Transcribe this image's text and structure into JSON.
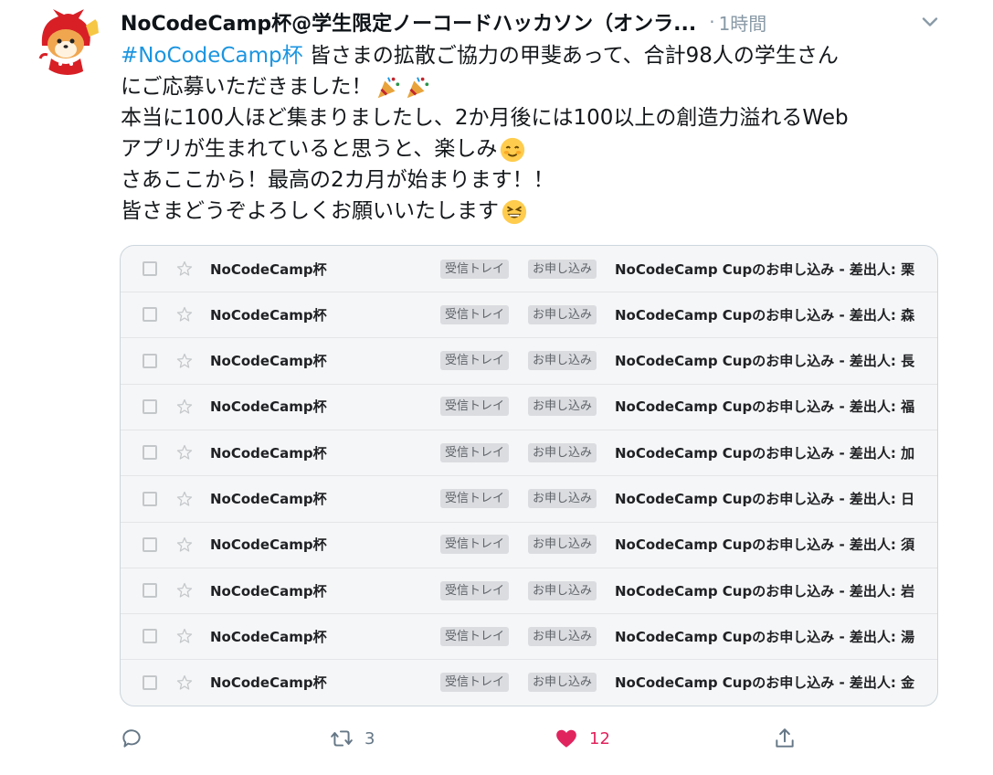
{
  "tweet": {
    "display_name": "NoCodeCamp杯@学生限定ノーコードハッカソン（オンラ...",
    "separator": "·",
    "time": "1時間",
    "hashtag": "#NoCodeCamp杯",
    "line1_rest": " 皆さまの拡散ご協力の甲斐あって、合計98人の学生さん",
    "line2": "にご応募いただきました！",
    "line3": "本当に100人ほど集まりましたし、2か月後には100以上の創造力溢れるWeb",
    "line4": "アプリが生まれていると思うと、楽しみ",
    "line5": "さあここから！最高の2カ月が始まります！！",
    "line6": "皆さまどうぞよろしくお願いいたします"
  },
  "icons": {
    "avatar": "mascot-avatar",
    "caret": "chevron-down-icon",
    "reply": "reply-icon",
    "retweet": "retweet-icon",
    "like": "heart-icon",
    "share": "share-icon",
    "emoji_party": "party-popper-icon",
    "emoji_smile": "smiling-face-icon",
    "emoji_grin": "grinning-squinting-face-icon"
  },
  "media": {
    "rows": [
      {
        "sender": "NoCodeCamp杯",
        "label1": "受信トレイ",
        "label2": "お申し込み",
        "subject": "NoCodeCamp Cupのお申し込み - 差出人: 栗"
      },
      {
        "sender": "NoCodeCamp杯",
        "label1": "受信トレイ",
        "label2": "お申し込み",
        "subject": "NoCodeCamp Cupのお申し込み - 差出人: 森"
      },
      {
        "sender": "NoCodeCamp杯",
        "label1": "受信トレイ",
        "label2": "お申し込み",
        "subject": "NoCodeCamp Cupのお申し込み - 差出人: 長"
      },
      {
        "sender": "NoCodeCamp杯",
        "label1": "受信トレイ",
        "label2": "お申し込み",
        "subject": "NoCodeCamp Cupのお申し込み - 差出人: 福"
      },
      {
        "sender": "NoCodeCamp杯",
        "label1": "受信トレイ",
        "label2": "お申し込み",
        "subject": "NoCodeCamp Cupのお申し込み - 差出人: 加"
      },
      {
        "sender": "NoCodeCamp杯",
        "label1": "受信トレイ",
        "label2": "お申し込み",
        "subject": "NoCodeCamp Cupのお申し込み - 差出人: 日"
      },
      {
        "sender": "NoCodeCamp杯",
        "label1": "受信トレイ",
        "label2": "お申し込み",
        "subject": "NoCodeCamp Cupのお申し込み - 差出人: 須"
      },
      {
        "sender": "NoCodeCamp杯",
        "label1": "受信トレイ",
        "label2": "お申し込み",
        "subject": "NoCodeCamp Cupのお申し込み - 差出人: 岩"
      },
      {
        "sender": "NoCodeCamp杯",
        "label1": "受信トレイ",
        "label2": "お申し込み",
        "subject": "NoCodeCamp Cupのお申し込み - 差出人: 湯"
      },
      {
        "sender": "NoCodeCamp杯",
        "label1": "受信トレイ",
        "label2": "お申し込み",
        "subject": "NoCodeCamp Cupのお申し込み - 差出人: 金"
      }
    ]
  },
  "actions": {
    "retweet_count": "3",
    "like_count": "12"
  },
  "colors": {
    "hashtag": "#1b95e0",
    "secondary_text": "#8899a6",
    "like": "#e0245e",
    "icon_gray": "#657786"
  }
}
